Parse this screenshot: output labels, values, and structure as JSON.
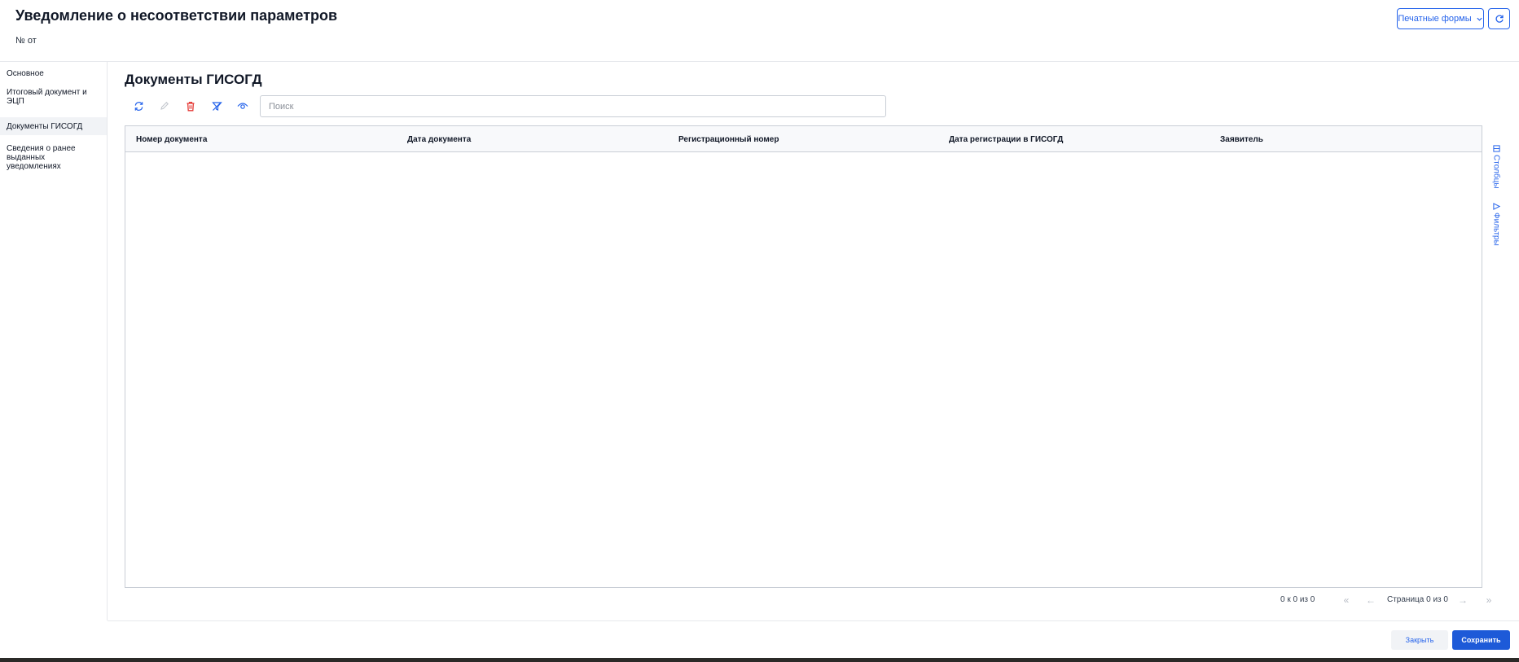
{
  "header": {
    "title": "Уведомление о несоответствии параметров",
    "doc_number": "№ от",
    "print_forms_label": "Печатные формы"
  },
  "sidebar": {
    "items": [
      {
        "label": "Основное"
      },
      {
        "label": "Итоговый документ и ЭЦП"
      },
      {
        "label": "Документы ГИСОГД"
      },
      {
        "label": "Сведения о ранее выданных уведомлениях"
      }
    ],
    "active_index": 2
  },
  "main": {
    "section_title": "Документы ГИСОГД",
    "search": {
      "placeholder": "Поиск",
      "value": ""
    }
  },
  "table": {
    "columns": [
      "Номер документа",
      "Дата документа",
      "Регистрационный номер",
      "Дата регистрации в ГИСОГД",
      "Заявитель"
    ],
    "rows": []
  },
  "side_tabs": {
    "columns_label": "Столбцы",
    "filters_label": "Фильтры"
  },
  "pagination": {
    "count_text": "0 к 0 из 0",
    "page_text": "Страница 0 из 0"
  },
  "footer": {
    "close_label": "Закрыть",
    "save_label": "Сохранить"
  },
  "colors": {
    "accent": "#2563eb",
    "primary_button": "#1d5ad8",
    "delete_icon": "#e53935",
    "border": "#c9ced6"
  }
}
